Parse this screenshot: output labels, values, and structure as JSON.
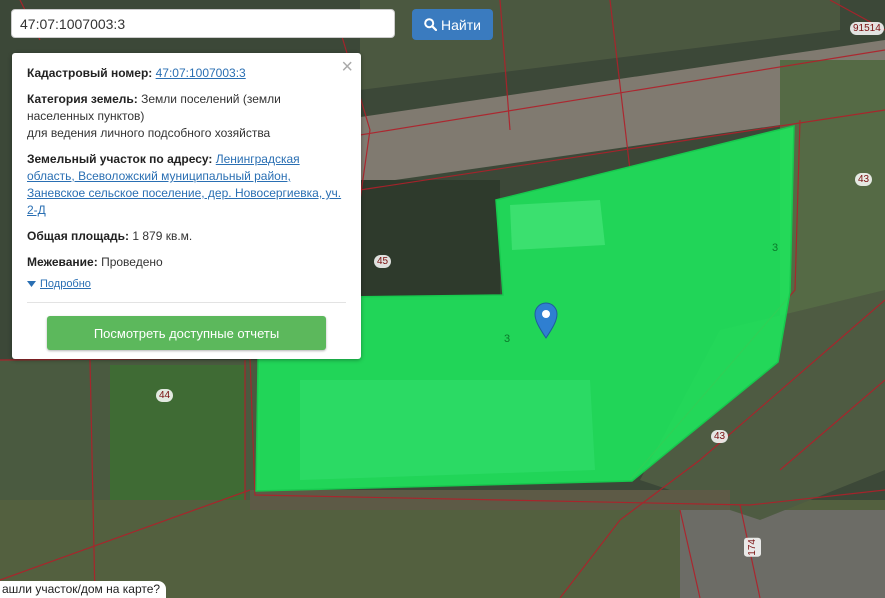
{
  "search": {
    "value": "47:07:1007003:3",
    "button_label": "Найти",
    "button_icon": "search-icon"
  },
  "popup": {
    "cadastral_label": "Кадастровый номер:",
    "cadastral_value": "47:07:1007003:3",
    "category_label": "Категория земель:",
    "category_value": "Земли поселений (земли населенных пунктов)",
    "category_purpose": "для ведения личного подсобного хозяйства",
    "address_label": "Земельный участок по адресу:",
    "address_value": "Ленинградская область, Всеволожский муниципальный район, Заневское сельское поселение, дер. Новосергиевка, уч. 2-Д",
    "area_label": "Общая площадь:",
    "area_value": "1 879 кв.м.",
    "survey_label": "Межевание:",
    "survey_value": "Проведено",
    "more_link": "Подробно",
    "reports_button": "Посмотреть доступные отчеты",
    "close_icon": "close-icon"
  },
  "map": {
    "plot_labels": [
      "45",
      "44",
      "43",
      "43",
      "174",
      "91514"
    ],
    "plot_numbers": [
      "3",
      "3"
    ],
    "marker_icon": "map-pin-icon",
    "highlight_color": "#1ee85c"
  },
  "bottom_question": "ашли участок/дом на карте?"
}
